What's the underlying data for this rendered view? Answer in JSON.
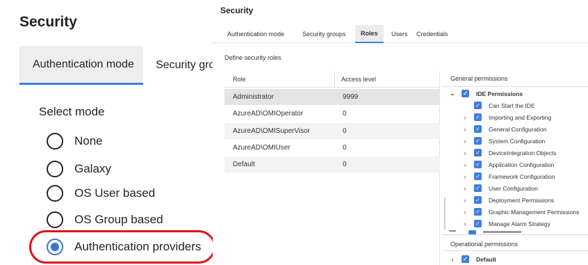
{
  "left": {
    "title": "Security",
    "tabs": [
      {
        "label": "Authentication mode",
        "active": true
      },
      {
        "label": "Security grou",
        "active": false
      }
    ],
    "select_mode_label": "Select mode",
    "options": [
      {
        "label": "None",
        "checked": false
      },
      {
        "label": "Galaxy",
        "checked": false
      },
      {
        "label": "OS User based",
        "checked": false
      },
      {
        "label": "OS Group based",
        "checked": false
      },
      {
        "label": "Authentication providers",
        "checked": true
      }
    ],
    "highlight_color": "#e0121b"
  },
  "right": {
    "title": "Security",
    "tabs": [
      {
        "label": "Authentication mode",
        "active": false
      },
      {
        "label": "Security groups",
        "active": false
      },
      {
        "label": "Roles",
        "active": true
      },
      {
        "label": "Users",
        "active": false
      },
      {
        "label": "Credentials",
        "active": false
      }
    ],
    "define_roles_label": "Define security roles",
    "roles_table": {
      "columns": [
        "Role",
        "Access level"
      ],
      "rows": [
        {
          "role": "Administrator",
          "level": "9999",
          "selected": true
        },
        {
          "role": "AzureAD\\OMIOperator",
          "level": "0",
          "selected": false
        },
        {
          "role": "AzureAD\\OMISuperVisor",
          "level": "0",
          "selected": false
        },
        {
          "role": "AzureAD\\OMIUser",
          "level": "0",
          "selected": false
        },
        {
          "role": "Default",
          "level": "0",
          "selected": false
        }
      ]
    },
    "general_permissions_label": "General permissions",
    "permissions_tree": [
      {
        "label": "IDE Permissions",
        "level": 0,
        "toggle": "expanded",
        "checked": true
      },
      {
        "label": "Can Start the IDE",
        "level": 1,
        "toggle": "none",
        "checked": true
      },
      {
        "label": "Importing and Exporting",
        "level": 1,
        "toggle": "collapsed",
        "checked": true
      },
      {
        "label": "General Configuration",
        "level": 1,
        "toggle": "collapsed",
        "checked": true
      },
      {
        "label": "System Configuration",
        "level": 1,
        "toggle": "collapsed",
        "checked": true
      },
      {
        "label": "DeviceIntegration Objects",
        "level": 1,
        "toggle": "collapsed",
        "checked": true
      },
      {
        "label": "Application Configuration",
        "level": 1,
        "toggle": "collapsed",
        "checked": true
      },
      {
        "label": "Framework Configuration",
        "level": 1,
        "toggle": "collapsed",
        "checked": true
      },
      {
        "label": "User Configuration",
        "level": 1,
        "toggle": "collapsed",
        "checked": true
      },
      {
        "label": "Deployment Permissions",
        "level": 1,
        "toggle": "collapsed",
        "checked": true
      },
      {
        "label": "Graphic Management Permissions",
        "level": 1,
        "toggle": "collapsed",
        "checked": true
      },
      {
        "label": "Manage Alarm Strategy",
        "level": 1,
        "toggle": "collapsed",
        "checked": true
      }
    ],
    "operational_permissions_label": "Operational permissions",
    "operational_tree": [
      {
        "label": "Default",
        "toggle": "collapsed",
        "checked": true
      }
    ],
    "icons": {
      "expanded": "chevron-down-icon",
      "collapsed": "chevron-right-icon",
      "checked": "checkbox-checked-icon"
    },
    "accent_color": "#3f7de0"
  }
}
